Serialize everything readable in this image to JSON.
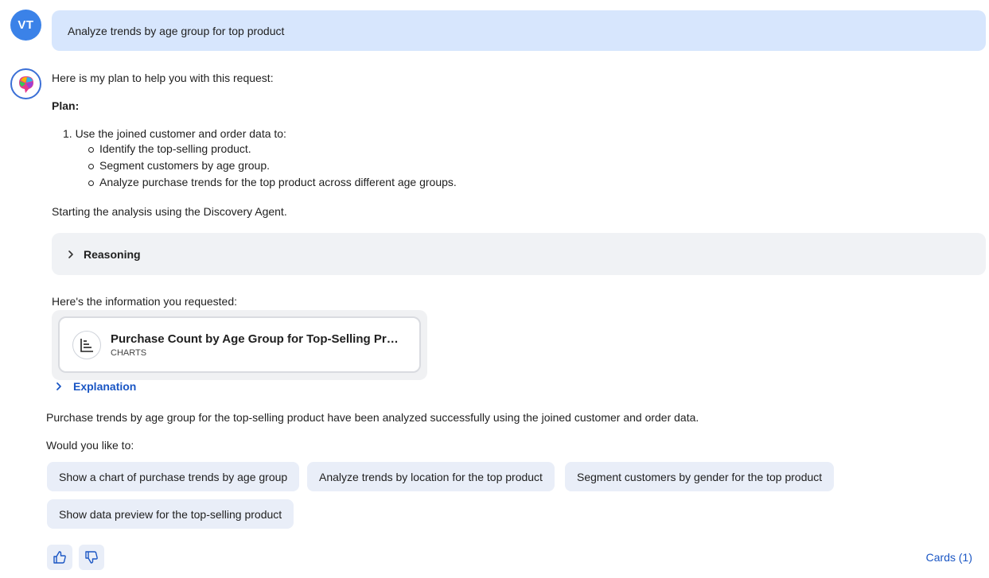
{
  "user": {
    "initials": "VT",
    "message": "Analyze trends by age group for top product"
  },
  "assistant": {
    "intro": "Here is my plan to help you with this request:",
    "plan_heading": "Plan:",
    "plan_step": "1. Use the joined customer and order data to:",
    "plan_substeps": [
      "Identify the top-selling product.",
      "Segment customers by age group.",
      "Analyze purchase trends for the top product across different age groups."
    ],
    "starting_text": "Starting the analysis using the Discovery Agent.",
    "reasoning_label": "Reasoning",
    "info_text": "Here's the information you requested:",
    "card": {
      "title": "Purchase Count by Age Group for Top-Selling Product",
      "type": "CHARTS",
      "icon": "bar-chart-icon"
    },
    "explanation_label": "Explanation",
    "summary": "Purchase trends by age group for the top-selling product have been analyzed successfully using the joined customer and order data.",
    "followup_prompt": "Would you like to:",
    "suggestions": [
      "Show a chart of purchase trends by age group",
      "Analyze trends by location for the top product",
      "Segment customers by gender for the top product",
      "Show data preview for the top-selling product"
    ],
    "cards_link": "Cards (1)"
  },
  "colors": {
    "accent": "#1a56c4",
    "avatar": "#3b82e8",
    "user_bubble": "#d7e6fd",
    "chip": "#e9eef8"
  }
}
